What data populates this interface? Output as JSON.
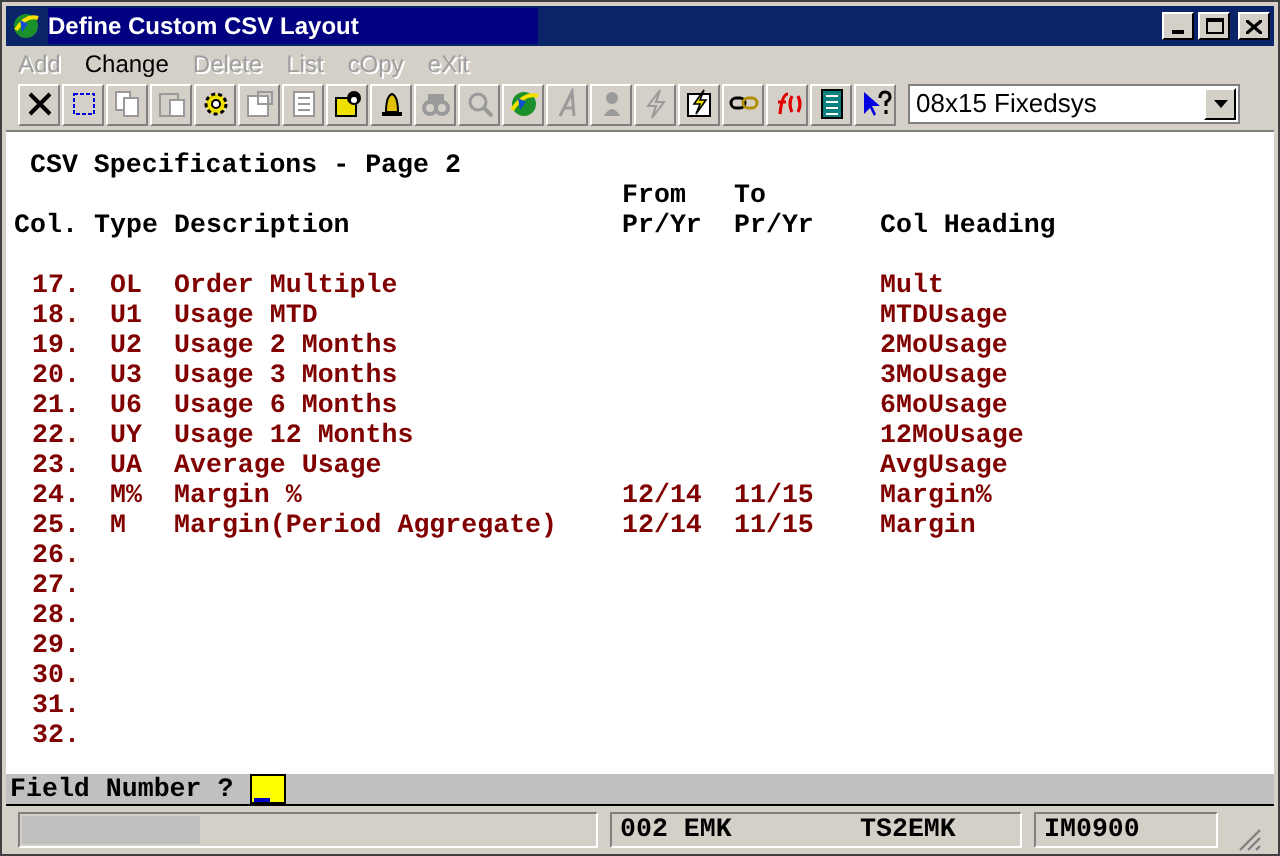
{
  "window": {
    "title": "Define Custom CSV Layout"
  },
  "menu": [
    {
      "label": "Add",
      "disabled": true
    },
    {
      "label": "Change",
      "disabled": false
    },
    {
      "label": "Delete",
      "disabled": true
    },
    {
      "label": "List",
      "disabled": true
    },
    {
      "label": "cOpy",
      "disabled": true
    },
    {
      "label": "eXit",
      "disabled": true
    }
  ],
  "toolbar": [
    {
      "disabled": false
    },
    {
      "disabled": false
    },
    {
      "disabled": true
    },
    {
      "disabled": true
    },
    {
      "disabled": false
    },
    {
      "disabled": true
    },
    {
      "disabled": true
    },
    {
      "disabled": false
    },
    {
      "disabled": false
    },
    {
      "disabled": true
    },
    {
      "disabled": true
    },
    {
      "disabled": false
    },
    {
      "disabled": true
    },
    {
      "disabled": true
    },
    {
      "disabled": true
    },
    {
      "disabled": false
    },
    {
      "disabled": false
    },
    {
      "disabled": false
    },
    {
      "disabled": false
    },
    {
      "disabled": false
    }
  ],
  "font_select": {
    "value": "08x15 Fixedsys"
  },
  "screen": {
    "title": "CSV Specifications - Page 2",
    "columns": [
      {
        "bottom": "Col."
      },
      {
        "bottom": "Type"
      },
      {
        "bottom": "Description"
      },
      {
        "top": "From",
        "bottom": "Pr/Yr"
      },
      {
        "top": "To",
        "bottom": "Pr/Yr"
      },
      {
        "bottom": "Col Heading"
      }
    ],
    "rows": [
      {
        "col": "17.",
        "type": "OL",
        "description": "Order Multiple",
        "heading": "Mult"
      },
      {
        "col": "18.",
        "type": "U1",
        "description": "Usage MTD",
        "heading": "MTDUsage"
      },
      {
        "col": "19.",
        "type": "U2",
        "description": "Usage 2 Months",
        "heading": "2MoUsage"
      },
      {
        "col": "20.",
        "type": "U3",
        "description": "Usage 3 Months",
        "heading": "3MoUsage"
      },
      {
        "col": "21.",
        "type": "U6",
        "description": "Usage 6 Months",
        "heading": "6MoUsage"
      },
      {
        "col": "22.",
        "type": "UY",
        "description": "Usage 12 Months",
        "heading": "12MoUsage"
      },
      {
        "col": "23.",
        "type": "UA",
        "description": "Average Usage",
        "heading": "AvgUsage"
      },
      {
        "col": "24.",
        "type": "M%",
        "description": "Margin %",
        "from": "12/14",
        "to": "11/15",
        "heading": "Margin%"
      },
      {
        "col": "25.",
        "type": "M",
        "description": "Margin(Period Aggregate)",
        "from": "12/14",
        "to": "11/15",
        "heading": "Margin"
      },
      {
        "col": "26."
      },
      {
        "col": "27."
      },
      {
        "col": "28."
      },
      {
        "col": "29."
      },
      {
        "col": "30."
      },
      {
        "col": "31."
      },
      {
        "col": "32."
      }
    ]
  },
  "prompt": {
    "label": "Field Number ?"
  },
  "status_bar": {
    "progress": {
      "level": 0.31
    },
    "fields": [
      "002 EMK",
      "TS2EMK",
      "IM0900"
    ]
  }
}
